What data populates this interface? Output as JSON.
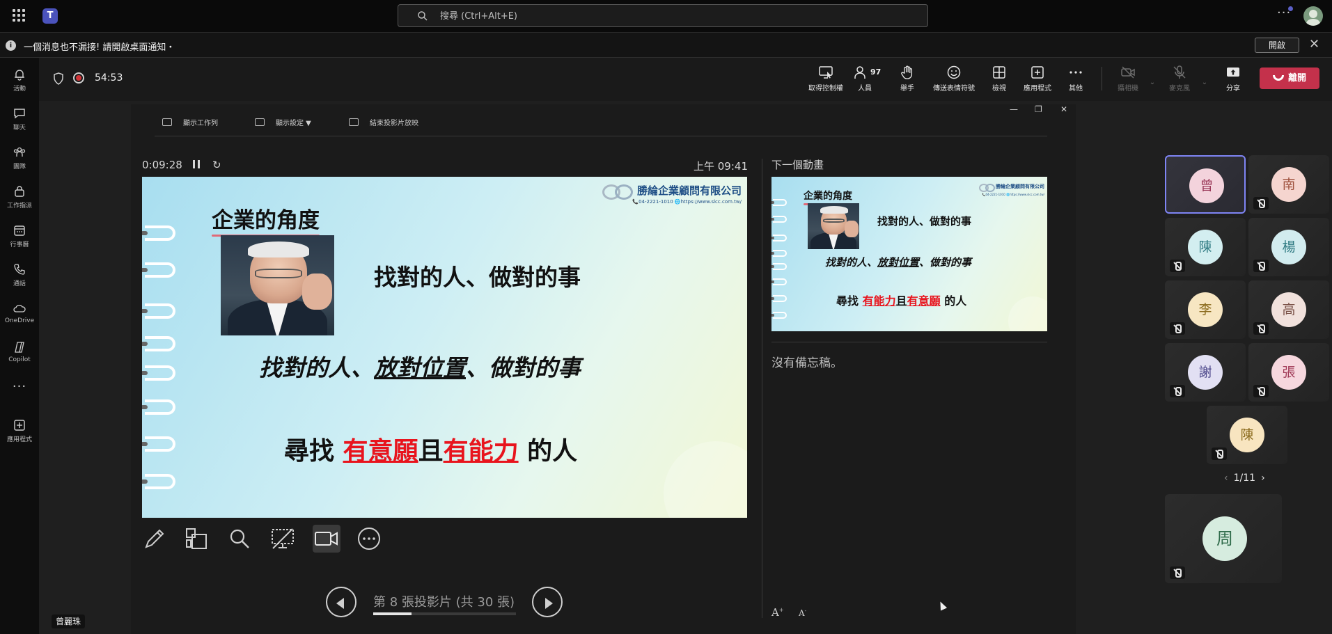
{
  "search": {
    "placeholder": "搜尋 (Ctrl+Alt+E)"
  },
  "notification": {
    "message": "一個消息也不漏接! 請開啟桌面通知・",
    "open_label": "開啟"
  },
  "rail": [
    {
      "label": "活動",
      "icon": "bell-icon"
    },
    {
      "label": "聊天",
      "icon": "chat-icon"
    },
    {
      "label": "團隊",
      "icon": "teams-icon"
    },
    {
      "label": "工作指派",
      "icon": "briefcase-icon"
    },
    {
      "label": "行事曆",
      "icon": "calendar-icon"
    },
    {
      "label": "通話",
      "icon": "phone-icon"
    },
    {
      "label": "OneDrive",
      "icon": "cloud-icon"
    },
    {
      "label": "Copilot",
      "icon": "copilot-icon"
    },
    {
      "label": "應用程式",
      "icon": "add-apps-icon"
    }
  ],
  "meeting": {
    "timer": "54:53",
    "people_count": "97",
    "controls": {
      "take_control": "取得控制權",
      "people": "人員",
      "raise_hand": "舉手",
      "reactions": "傳送表情符號",
      "view": "檢視",
      "apps": "應用程式",
      "more": "其他",
      "camera": "攝相機",
      "mic": "麥克風",
      "share": "分享"
    },
    "leave_label": "離開"
  },
  "presenter": {
    "toolbar": {
      "show_taskbar": "顯示工作列",
      "display_settings": "顯示設定 ▼",
      "end_slideshow": "結束投影片放映"
    },
    "elapsed": "0:09:28",
    "clock": "上午 09:41",
    "next_label": "下一個動畫",
    "notes": "沒有備忘稿。",
    "slide_counter": "第 8 張投影片 (共 30 張)",
    "progress": 0.27,
    "presenter_name": "曾麗珠"
  },
  "slide": {
    "title": "企業的角度",
    "logo_name": "勝綸企業顧問有限公司",
    "logo_sub": "📞04-2221-1010  🌐https://www.slcc.com.tw/",
    "line1": "找對的人、做對的事",
    "line2_a": "找對的人、",
    "line2_b": "放對位置",
    "line2_c": "、做對的事",
    "line3_a": "尋找 ",
    "line3_b": "有意願",
    "line3_c": "且",
    "line3_d": "有能力",
    "line3_e": " 的人"
  },
  "next_slide": {
    "line3_b": "有能力",
    "line3_d": "有意願"
  },
  "participants": [
    {
      "initial": "曾",
      "bg": "#f3d3dc",
      "fg": "#9b3a5a",
      "muted": false,
      "selected": true
    },
    {
      "initial": "南",
      "bg": "#f5d5cf",
      "fg": "#a0533f",
      "muted": true,
      "selected": false
    },
    {
      "initial": "陳",
      "bg": "#d3eef0",
      "fg": "#2f7a82",
      "muted": true,
      "selected": false
    },
    {
      "initial": "楊",
      "bg": "#d2ecef",
      "fg": "#2f7a82",
      "muted": true,
      "selected": false
    },
    {
      "initial": "李",
      "bg": "#f7e6c2",
      "fg": "#8a6a1c",
      "muted": true,
      "selected": false
    },
    {
      "initial": "高",
      "bg": "#f1e1dc",
      "fg": "#7a5147",
      "muted": true,
      "selected": false
    },
    {
      "initial": "謝",
      "bg": "#e2e0f3",
      "fg": "#4f4a8c",
      "muted": true,
      "selected": false
    },
    {
      "initial": "張",
      "bg": "#f6d7de",
      "fg": "#a03a57",
      "muted": true,
      "selected": false
    },
    {
      "initial": "陳",
      "bg": "#f8e5c0",
      "fg": "#8a6a1c",
      "muted": true,
      "selected": false
    }
  ],
  "pager": "1/11",
  "spotlight": {
    "initial": "周",
    "bg": "#d6ecdf",
    "fg": "#2f6b4a",
    "muted": true
  }
}
